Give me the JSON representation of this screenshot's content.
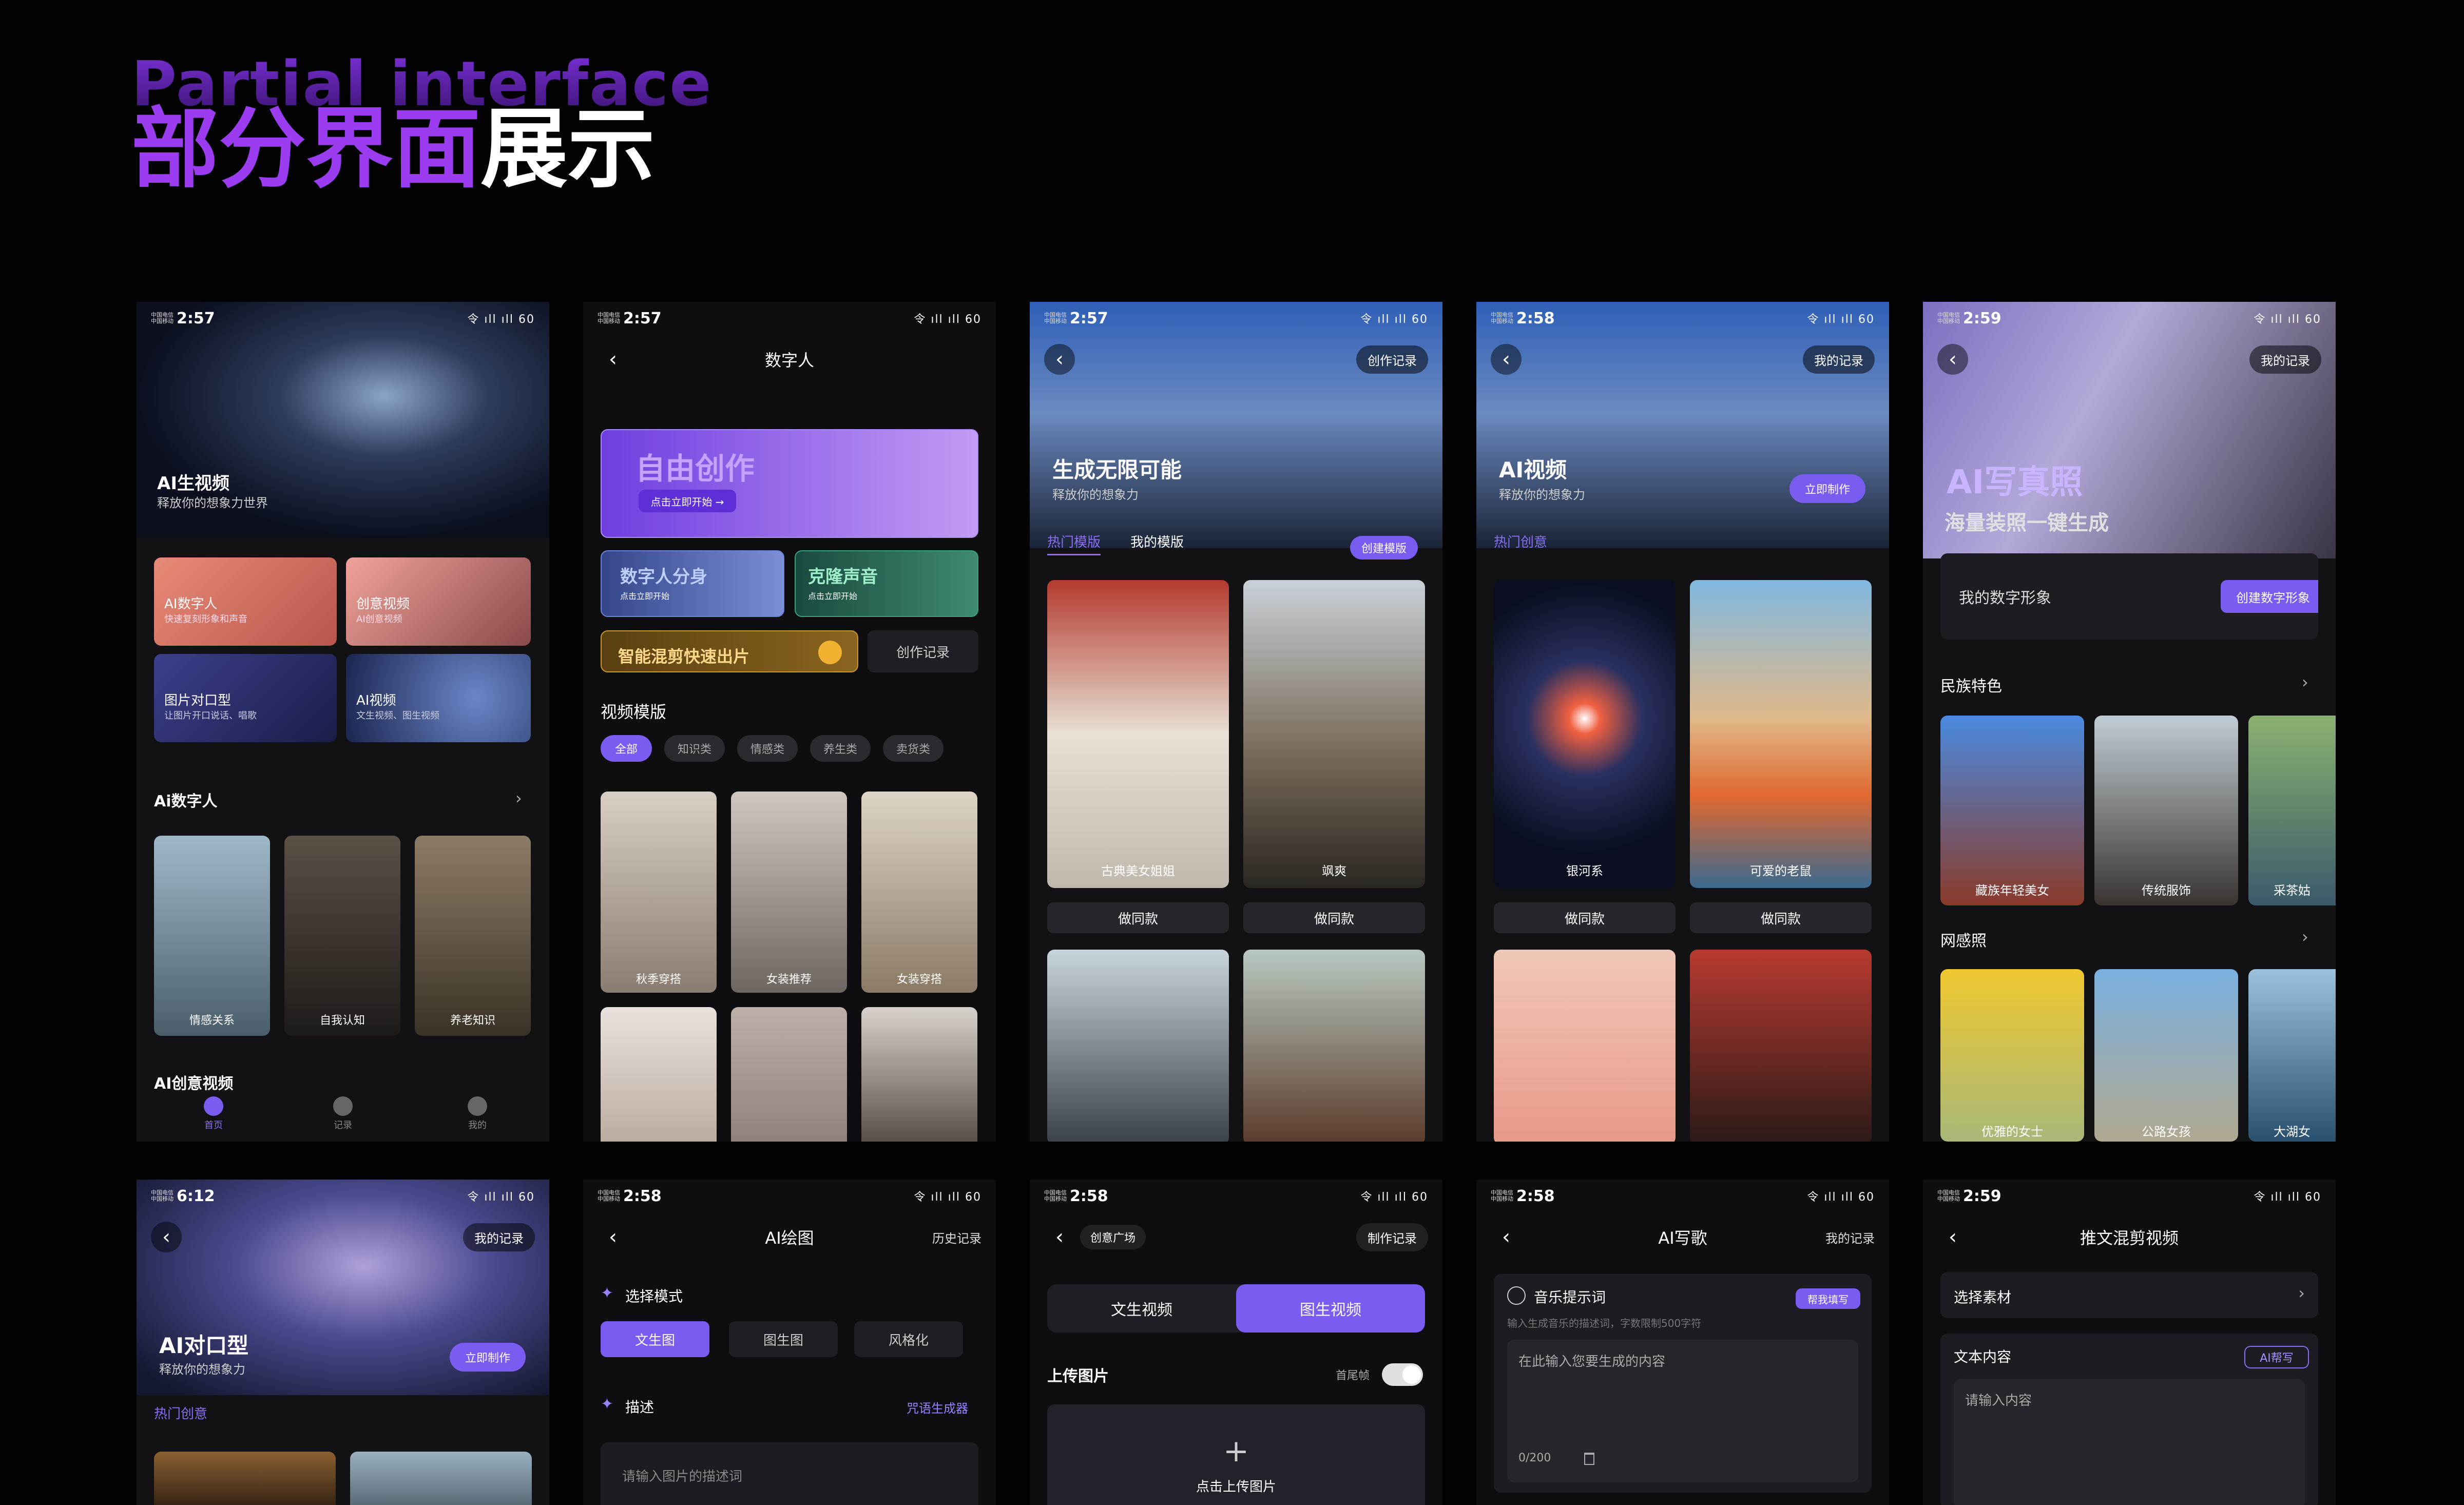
{
  "header": {
    "en": "Partial interface",
    "cn_purple": "部分界面",
    "cn_white": "展示"
  },
  "status": {
    "carrier1": "中国电信",
    "carrier2": "中国移动",
    "right": "令 ıll ıll 60",
    "t1": "2:57",
    "t2": "2:57",
    "t3": "2:57",
    "t4": "2:58",
    "t5": "2:59",
    "t6": "6:12",
    "t7": "2:58",
    "t8": "2:58",
    "t9": "2:58",
    "t10": "2:59"
  },
  "p1": {
    "hero_title": "AI生视频",
    "hero_sub": "释放你的想象力世界",
    "c1": "AI数字人",
    "c1s": "快速复刻形象和声音",
    "c2": "创意视频",
    "c2s": "AI创意视频",
    "c3": "图片对口型",
    "c3s": "让图片开口说话、唱歌",
    "c4": "AI视频",
    "c4s": "文生视频、图生视频",
    "sec1": "Ai数字人",
    "f1": "情感关系",
    "f2": "自我认知",
    "f3": "养老知识",
    "sec2": "AI创意视频",
    "tab1": "首页",
    "tab2": "记录",
    "tab3": "我的"
  },
  "p2": {
    "title": "数字人",
    "banner": "自由创作",
    "banner_btn": "点击立即开始 →",
    "b2": "数字人分身",
    "b2s": "点击立即开始",
    "b3": "克隆声音",
    "b3s": "点击立即开始",
    "b4": "智能混剪快速出片",
    "b5": "创作记录",
    "sec": "视频模版",
    "chips": [
      "全部",
      "知识类",
      "情感类",
      "养生类",
      "卖货类"
    ],
    "t1": "秋季穿搭",
    "t2": "女装推荐",
    "t3": "女装穿搭"
  },
  "p3": {
    "pill": "创作记录",
    "hero_title": "生成无限可能",
    "hero_sub": "释放你的想象力",
    "tab1": "热门模版",
    "tab2": "我的模版",
    "create": "创建模版",
    "c1": "古典美女姐姐",
    "c2": "飒爽",
    "do1": "做同款",
    "do2": "做同款"
  },
  "p4": {
    "pill": "我的记录",
    "hero_title": "AI视频",
    "hero_sub": "释放你的想象力",
    "make": "立即制作",
    "tab": "热门创意",
    "c1": "银河系",
    "c2": "可爱的老鼠",
    "do1": "做同款",
    "do2": "做同款"
  },
  "p5": {
    "pill": "我的记录",
    "hero_title": "AI写真照",
    "hero_sub": "海量装照一键生成",
    "mine": "我的数字形象",
    "create": "创建数字形象",
    "sec1": "民族特色",
    "c1": "藏族年轻美女",
    "c2": "传统服饰",
    "c3": "采茶姑",
    "sec2": "网感照",
    "c4": "优雅的女士",
    "c5": "公路女孩",
    "c6": "大湖女"
  },
  "p6": {
    "pill": "我的记录",
    "hero_title": "AI对口型",
    "hero_sub": "释放你的想象力",
    "make": "立即制作",
    "tab": "热门创意"
  },
  "p7": {
    "title": "AI绘图",
    "right": "历史记录",
    "mode": "选择模式",
    "m1": "文生图",
    "m2": "图生图",
    "m3": "风格化",
    "desc": "描述",
    "right2": "咒语生成器",
    "ph": "请输入图片的描述词"
  },
  "p8": {
    "pill1": "创意广场",
    "pill2": "制作记录",
    "t1": "文生视频",
    "t2": "图生视频",
    "upload": "上传图片",
    "tail": "首尾帧",
    "add": "点击上传图片"
  },
  "p9": {
    "title": "AI写歌",
    "right": "我的记录",
    "prompt": "音乐提示词",
    "help": "帮我填写",
    "hint": "输入生成音乐的描述词，字数限制500字符",
    "ph": "在此输入您要生成的内容",
    "count": "0/200"
  },
  "p10": {
    "title": "推文混剪视频",
    "sel": "选择素材",
    "text": "文本内容",
    "ai": "AI帮写",
    "ph": "请输入内容"
  }
}
